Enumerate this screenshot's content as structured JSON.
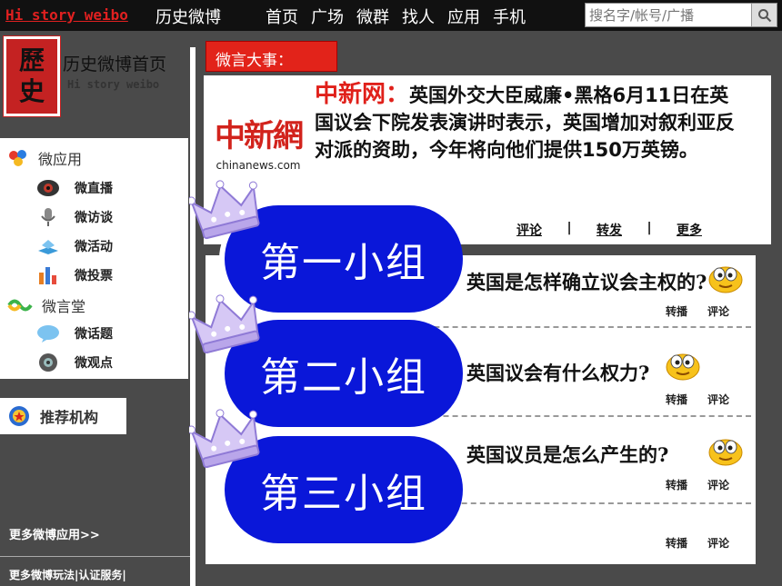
{
  "topbar": {
    "brand_en": "Hi story weibo",
    "brand_cn": "历史微博",
    "nav": [
      "首页",
      "广场",
      "微群",
      "找人",
      "应用",
      "手机"
    ],
    "search_placeholder": "搜名字/帐号/广播"
  },
  "logo": {
    "line1": "歷",
    "line2": "史"
  },
  "home": {
    "title": "历史微博首页",
    "subtitle": "Hi story weibo"
  },
  "sidebar": {
    "apps_title": "微应用",
    "apps": [
      {
        "label": "微直播",
        "icon": "camera-icon"
      },
      {
        "label": "微访谈",
        "icon": "microphone-icon"
      },
      {
        "label": "微活动",
        "icon": "activity-icon"
      },
      {
        "label": "微投票",
        "icon": "bar-chart-icon"
      }
    ],
    "hall_title": "微言堂",
    "hall": [
      {
        "label": "微话题",
        "icon": "speech-bubble-icon"
      },
      {
        "label": "微观点",
        "icon": "speaker-icon"
      }
    ],
    "recommend": "推荐机构",
    "more_apps": "更多微博应用>>",
    "more_play": "更多微博玩法|认证服务|"
  },
  "main": {
    "headline_tab": "微言大事：",
    "news": {
      "logo_mark": "中新網",
      "logo_url": "chinanews.com",
      "source": "中新网",
      "colon": "：",
      "text": "英国外交大臣威廉•黑格6月11日在英国议会下院发表演讲时表示，英国增加对叙利亚反对派的资助，今年将向他们提供150万英镑。"
    },
    "actions": {
      "comment": "评论",
      "repost": "转发",
      "more": "更多",
      "sep": "|"
    },
    "questions": [
      {
        "text": "英国是怎样确立议会主权的?",
        "repost": "转播",
        "comment": "评论"
      },
      {
        "text": "英国议会有什么权力?",
        "repost": "转播",
        "comment": "评论"
      },
      {
        "text": "英国议员是怎么产生的?",
        "repost": "转播",
        "comment": "评论"
      },
      {
        "repost": "转播",
        "comment": "评论"
      }
    ],
    "groups": [
      "第一小组",
      "第二小组",
      "第三小组"
    ]
  },
  "colors": {
    "bubble_blue": "#0a17d9",
    "brand_red": "#e2231a",
    "crown_purple": "#b9a6ea"
  }
}
